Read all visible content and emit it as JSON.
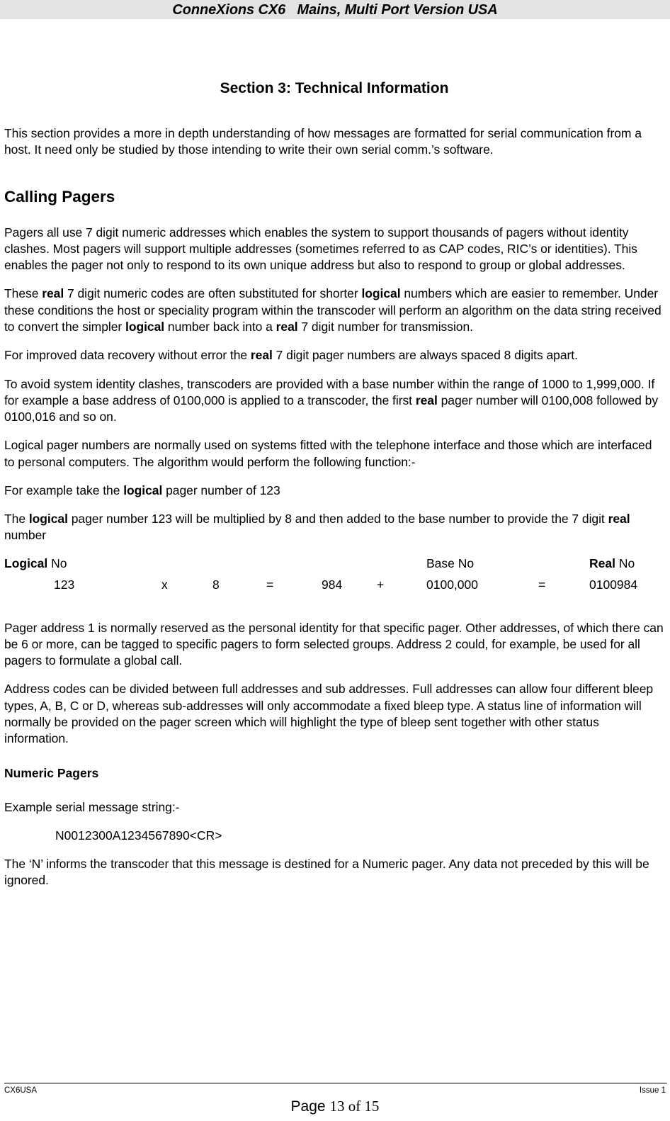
{
  "header": {
    "title": "ConneXions CX6   Mains, Multi Port Version USA",
    "background": "#e3e3e3"
  },
  "section": {
    "title": "Section 3: Technical Information",
    "intro": "This section provides a more in depth understanding of how messages are formatted for serial communication from a host. It need only be studied by those intending to write their own serial comm.’s software."
  },
  "calling_pagers": {
    "heading": "Calling Pagers",
    "p1": "Pagers all use 7 digit numeric addresses which enables the system to support thousands of pagers without identity clashes. Most pagers will support multiple addresses (sometimes referred to as CAP codes, RIC’s or identities). This enables the pager not only to respond to its own unique address but also to respond to group or global addresses.",
    "p2_a": "These ",
    "p2_b": "real",
    "p2_c": " 7 digit numeric codes are often substituted for shorter ",
    "p2_d": "logical",
    "p2_e": " numbers which are easier to remember. Under these conditions the host or speciality program within the transcoder will perform an algorithm on the data string received to convert the simpler ",
    "p2_f": "logical",
    "p2_g": " number back into a ",
    "p2_h": "real",
    "p2_i": " 7 digit number for transmission.",
    "p3_a": "For improved data recovery without error the ",
    "p3_b": "real",
    "p3_c": " 7 digit pager numbers are always spaced 8 digits apart.",
    "p4_a": "To avoid system identity clashes, transcoders are provided with a base number within the range of 1000 to 1,999,000.  If for example a base address of 0100,000 is applied to a transcoder, the first ",
    "p4_b": "real",
    "p4_c": " pager number will 0100,008 followed by 0100,016 and so on.",
    "p5": "Logical pager numbers are normally used on systems fitted with the telephone interface and those which are interfaced to personal computers. The algorithm would perform the following function:-",
    "p6_a": "For example take the ",
    "p6_b": "logical",
    "p6_c": " pager number of 123",
    "p7_a": "The ",
    "p7_b": "logical",
    "p7_c": " pager number 123 will be multiplied by 8 and then added to the base number to provide the 7 digit ",
    "p7_d": "real",
    "p7_e": " number",
    "p8": "Pager address 1 is normally reserved as the personal identity for that specific pager.  Other addresses, of which there can be 6 or more, can be tagged to specific pagers to form selected groups.  Address 2 could, for example, be used for all pagers to formulate a global call.",
    "p9": "Address codes can be divided between full addresses and sub addresses. Full addresses can allow four different bleep types, A, B, C or D, whereas sub-addresses will only accommodate a fixed bleep type. A status line of information will normally be provided on the pager screen which will highlight the type of bleep sent together with other status information."
  },
  "calculation": {
    "headers": {
      "logical_bold": "Logical",
      "logical_rest": " No",
      "base": "Base No",
      "real_bold": "Real",
      "real_rest": " No"
    },
    "row": {
      "logical_value": "123",
      "operator_multiply": "x",
      "multiplier": "8",
      "operator_equals_1": "=",
      "product": "984",
      "operator_plus": "+",
      "base_value": "0100,000",
      "operator_equals_2": "=",
      "real_value": "0100984"
    }
  },
  "numeric_pagers": {
    "heading": "Numeric Pagers",
    "example_label": "Example serial message string:-",
    "example_string": "N0012300A1234567890<CR>",
    "explanation": "The ‘N’ informs the transcoder that this message is destined for a Numeric pager.  Any data not preceded by this will be ignored."
  },
  "footer": {
    "doc_code": "CX6USA",
    "issue": "Issue 1",
    "page_word": "Page ",
    "page_numbers": "13 of 15"
  }
}
